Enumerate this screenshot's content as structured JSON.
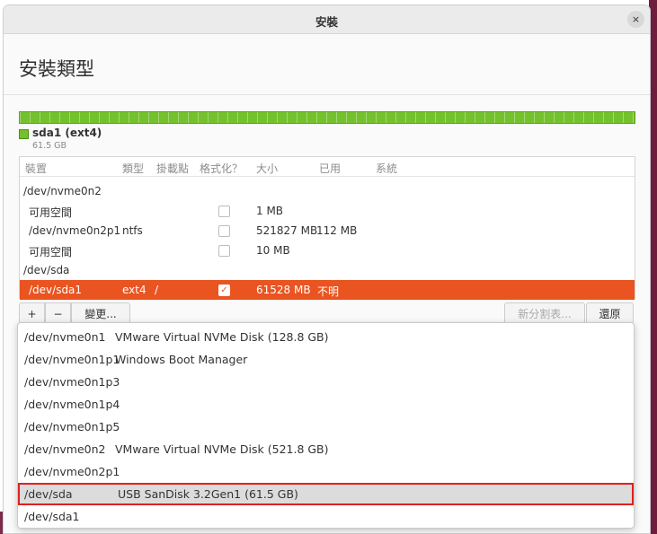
{
  "window": {
    "title": "安裝",
    "close_symbol": "×"
  },
  "page": {
    "heading": "安裝類型"
  },
  "partition_bar": {
    "color": "#73c12c",
    "legend_name": "sda1 (ext4)",
    "legend_size": "61.5 GB"
  },
  "table": {
    "headers": [
      "裝置",
      "類型",
      "掛載點",
      "格式化？",
      "大小",
      "已用",
      "系統"
    ],
    "rows": [
      {
        "device": "/dev/nvme0n2",
        "type": "",
        "mount": "",
        "format": null,
        "size": "",
        "used": "",
        "system": ""
      },
      {
        "device": "可用空間",
        "type": "",
        "mount": "",
        "format": false,
        "size": "1 MB",
        "used": "",
        "system": ""
      },
      {
        "device": "/dev/nvme0n2p1",
        "type": "ntfs",
        "mount": "",
        "format": false,
        "size": "521827 MB",
        "used": "112 MB",
        "system": ""
      },
      {
        "device": "可用空間",
        "type": "",
        "mount": "",
        "format": false,
        "size": "10 MB",
        "used": "",
        "system": ""
      },
      {
        "device": "/dev/sda",
        "type": "",
        "mount": "",
        "format": null,
        "size": "",
        "used": "",
        "system": ""
      },
      {
        "device": "/dev/sda1",
        "type": "ext4",
        "mount": "/",
        "format": true,
        "size": "61528 MB",
        "used": "不明",
        "system": ""
      }
    ],
    "selected_row": 5,
    "selected_color": "#e95420"
  },
  "buttons": {
    "add": "+",
    "remove": "−",
    "change": "變更...",
    "new_table": "新分割表...",
    "revert": "還原"
  },
  "dropdown": {
    "items": [
      {
        "device": "/dev/nvme0n1",
        "description": "VMware Virtual NVMe Disk (128.8 GB)"
      },
      {
        "device": "/dev/nvme0n1p1",
        "description": "Windows Boot Manager"
      },
      {
        "device": "/dev/nvme0n1p3",
        "description": ""
      },
      {
        "device": "/dev/nvme0n1p4",
        "description": ""
      },
      {
        "device": "/dev/nvme0n1p5",
        "description": ""
      },
      {
        "device": "/dev/nvme0n2",
        "description": "VMware Virtual NVMe Disk (521.8 GB)"
      },
      {
        "device": "/dev/nvme0n2p1",
        "description": ""
      },
      {
        "device": "/dev/sda",
        "description": "USB  SanDisk 3.2Gen1 (61.5 GB)"
      },
      {
        "device": "/dev/sda1",
        "description": ""
      }
    ],
    "highlighted_index": 7,
    "highlight_color": "#e21f1f"
  }
}
